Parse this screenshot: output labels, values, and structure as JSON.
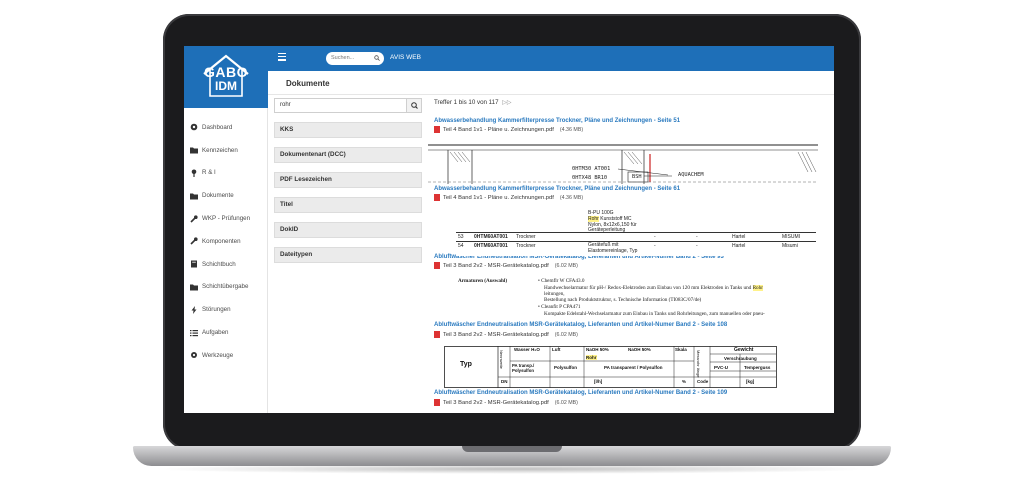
{
  "brand": {
    "logo_line1": "GABO",
    "logo_line2": "IDM",
    "color": "#1e6fb8"
  },
  "topbar": {
    "search_placeholder": "Suchen...",
    "app_name": "AVIS WEB"
  },
  "sidebar": {
    "items": [
      {
        "label": "Dashboard",
        "icon": "dashboard-icon"
      },
      {
        "label": "Kennzeichen",
        "icon": "folder-icon"
      },
      {
        "label": "R & I",
        "icon": "pin-icon"
      },
      {
        "label": "Dokumente",
        "icon": "folder-icon"
      },
      {
        "label": "WKP - Prüfungen",
        "icon": "wrench-icon"
      },
      {
        "label": "Komponenten",
        "icon": "wrench-icon"
      },
      {
        "label": "Schichtbuch",
        "icon": "book-icon"
      },
      {
        "label": "Schichtübergabe",
        "icon": "folder-icon"
      },
      {
        "label": "Störungen",
        "icon": "bolt-icon"
      },
      {
        "label": "Aufgaben",
        "icon": "list-icon"
      },
      {
        "label": "Werkzeuge",
        "icon": "gear-icon"
      }
    ]
  },
  "page": {
    "title": "Dokumente"
  },
  "filters": {
    "search_value": "rohr",
    "facets": [
      "KKS",
      "Dokumentenart (DCC)",
      "PDF Lesezeichen",
      "Titel",
      "DokID",
      "Dateitypen"
    ]
  },
  "results": {
    "hits_text": "Treffer 1 bis 10 von 117",
    "hits_nav": "▷▷",
    "items": [
      {
        "title": "Abwasserbehandlung Kammerfilterpresse Trockner, Pläne und Zeichnungen - Seite 51",
        "file": "Teil 4 Band 1v1 - Pläne u. Zeichnungen.pdf",
        "size": "(4.36 MB)"
      },
      {
        "title": "Abwasserbehandlung Kammerfilterpresse Trockner, Pläne und Zeichnungen - Seite 61",
        "file": "Teil 4 Band 1v1 - Pläne u. Zeichnungen.pdf",
        "size": "(4.36 MB)"
      },
      {
        "title": "Abluftwäscher Endneutralisation MSR-Gerätekatalog, Lieferanten und Artikel-Numer Band 2 - Seite 93",
        "file": "Teil 3 Band 2v2 - MSR-Gerätekatalog.pdf",
        "size": "(6.02 MB)"
      },
      {
        "title": "Abluftwäscher Endneutralisation MSR-Gerätekatalog, Lieferanten und Artikel-Numer Band 2 - Seite 108",
        "file": "Teil 3 Band 2v2 - MSR-Gerätekatalog.pdf",
        "size": "(6.02 MB)"
      },
      {
        "title": "Abluftwäscher Endneutralisation MSR-Gerätekatalog, Lieferanten und Artikel-Numer Band 2 - Seite 109",
        "file": "Teil 3 Band 2v2 - MSR-Gerätekatalog.pdf",
        "size": "(6.02 MB)"
      }
    ]
  },
  "previews": {
    "drawing": {
      "tag1": "0HTM30 AT001",
      "tag2": "0HTX48 BR10",
      "label_bsh": "BSH",
      "label_right": "AQUACHEM"
    },
    "table1": {
      "top_code": "B-PU 100G",
      "hl_word": "Rohr",
      "top_rest": "Kunststoff MC",
      "line2": "Nylon, 8x12x6,150 für",
      "line3": "Geräteperleitung",
      "rows": [
        {
          "n": "53",
          "code": "0HTM60AT001",
          "name": "Trockner",
          "desc": "",
          "d1": "-",
          "d2": "-",
          "maker": "Hartel",
          "supplier": "MISUMI"
        },
        {
          "n": "54",
          "code": "0HTM60AT001",
          "name": "Trockner",
          "desc": "Gerätefuß mit Elastomereinlage, Typ",
          "d1": "-",
          "d2": "-",
          "maker": "Hartel",
          "supplier": "Misumi"
        }
      ]
    },
    "doc3": {
      "left": "Armaturen (Auswahl)",
      "b1": "Chemflr W CFA43.0",
      "b1a": "Handwechselarmatur für pH-/ Redox-Elektroden zum Einbau von 120 mm Elektroden in Tanks und ",
      "b1a_hl": "Rohr",
      "b1b": "leitungen,",
      "b1c": "Bestellung nach Produktstruktur, s. Technische Information (TI083C/07/de)",
      "b2": "Cleanfit P CPA471",
      "b2a": "Kompakte Edelstahl-Wechselarmatur zum Einbau in Tanks und Rohrleitungen, zum manuellen oder pneu-"
    },
    "table2": {
      "col_typ": "Typ",
      "col_nennweite": "Nennweite",
      "h1": "Gewicht",
      "h2": "Verschraubung",
      "h3": "PVC-U",
      "h4": "Temperguss",
      "hl": "Rohr",
      "c1": "PA transp./ Polysulfon",
      "c2": "Polysulfon",
      "c3": "PA transparent / Polysulfon",
      "dn": "DN",
      "unit1": "[l/h]",
      "unit2": "%",
      "unit3": "Code",
      "unit4": "[kg]",
      "top1": "Wasser H₂O",
      "top2": "Luft",
      "top3": "NaOH 50%",
      "top4": "NaOH 50%",
      "top5": "Skala",
      "top6": "Messrohr länge"
    }
  }
}
